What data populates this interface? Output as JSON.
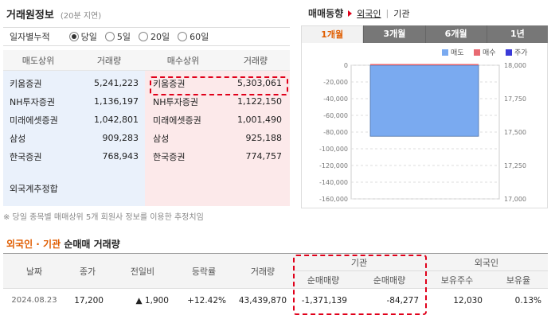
{
  "header": {
    "title": "거래원정보",
    "delay": "(20분 지연)"
  },
  "period": {
    "label": "일자별누적",
    "options": [
      {
        "label": "당일",
        "selected": true
      },
      {
        "label": "5일",
        "selected": false
      },
      {
        "label": "20일",
        "selected": false
      },
      {
        "label": "60일",
        "selected": false
      }
    ]
  },
  "rank": {
    "headers": {
      "sell": "매도상위",
      "sell_vol": "거래량",
      "buy": "매수상위",
      "buy_vol": "거래량"
    },
    "sell": [
      {
        "name": "키움증권",
        "volume": "5,241,223"
      },
      {
        "name": "NH투자증권",
        "volume": "1,136,197"
      },
      {
        "name": "미래에셋증권",
        "volume": "1,042,801"
      },
      {
        "name": "삼성",
        "volume": "909,283"
      },
      {
        "name": "한국증권",
        "volume": "768,943"
      }
    ],
    "buy": [
      {
        "name": "키움증권",
        "volume": "5,303,061"
      },
      {
        "name": "NH투자증권",
        "volume": "1,122,150"
      },
      {
        "name": "미래에셋증권",
        "volume": "1,001,490"
      },
      {
        "name": "삼성",
        "volume": "925,188"
      },
      {
        "name": "한국증권",
        "volume": "774,757"
      }
    ],
    "foreign_total_label": "외국계추정합"
  },
  "note": "※ 당일 종목별 매매상위 5개 회원사 정보를 이용한 추정치임",
  "trend": {
    "title": "매매동향",
    "links": {
      "foreign": "외국인",
      "institution": "기관"
    },
    "tabs": [
      "1개월",
      "3개월",
      "6개월",
      "1년"
    ],
    "active_tab": 0
  },
  "chart_data": {
    "type": "bar",
    "legend": [
      "매도",
      "매수",
      "주가"
    ],
    "legend_colors": {
      "매도": "#7aaaf0",
      "매수": "#e86a72",
      "주가": "#3a3ad8"
    },
    "legend_position": "top-right",
    "series": [
      {
        "name": "매도",
        "values": [
          -85000
        ]
      },
      {
        "name": "매수",
        "values": [
          1500
        ]
      }
    ],
    "y_left": {
      "ticks": [
        "0",
        "-20,000",
        "-40,000",
        "-60,000",
        "-80,000",
        "-100,000",
        "-120,000",
        "-140,000",
        "-160,000"
      ],
      "range": [
        -160000,
        0
      ]
    },
    "y_right": {
      "ticks": [
        "18,000",
        "17,750",
        "17,500",
        "17,250",
        "17,000"
      ],
      "range": [
        17000,
        18000
      ]
    },
    "grid": true
  },
  "net": {
    "title_red": "외국인 · 기관",
    "title_black": "순매매 거래량",
    "headers": {
      "date": "날짜",
      "close": "종가",
      "change": "전일비",
      "rate": "등락률",
      "volume": "거래량",
      "inst": "기관",
      "inst_net": "순매매량",
      "foreign": "외국인",
      "foreign_net": "순매매량",
      "holding": "보유주수",
      "ratio": "보유율"
    },
    "rows": [
      {
        "date": "2024.08.23",
        "close": "17,200",
        "change": "▲ 1,900",
        "rate": "+12.42%",
        "volume": "43,439,870",
        "inst_net": "-1,371,139",
        "foreign_net": "-84,277",
        "holding": "12,030",
        "ratio": "0.13%"
      }
    ]
  }
}
